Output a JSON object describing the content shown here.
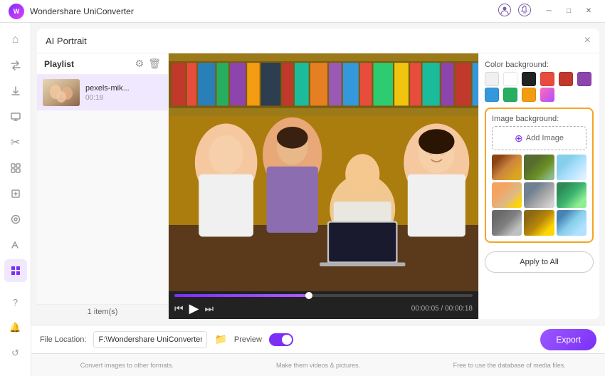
{
  "app": {
    "title": "Wondershare UniConverter",
    "logo_letter": "W"
  },
  "title_bar": {
    "controls": [
      "minimize",
      "maximize",
      "close"
    ],
    "icons": [
      "user-icon",
      "bell-icon"
    ]
  },
  "sidebar": {
    "items": [
      {
        "id": "home",
        "icon": "⌂",
        "label": "Home"
      },
      {
        "id": "convert",
        "icon": "⇄",
        "label": "Convert"
      },
      {
        "id": "download",
        "icon": "↓",
        "label": "Download"
      },
      {
        "id": "screen",
        "icon": "▣",
        "label": "Screen"
      },
      {
        "id": "cut",
        "icon": "✂",
        "label": "Cut"
      },
      {
        "id": "merge",
        "icon": "⊞",
        "label": "Merge"
      },
      {
        "id": "compress",
        "icon": "⊡",
        "label": "Compress"
      },
      {
        "id": "effects",
        "icon": "✦",
        "label": "Effects"
      },
      {
        "id": "tools",
        "icon": "⊞",
        "label": "Tools"
      },
      {
        "id": "grid",
        "icon": "⚏",
        "label": "Grid",
        "active": true
      }
    ],
    "bottom_icons": [
      {
        "id": "help",
        "icon": "?"
      },
      {
        "id": "bell",
        "icon": "🔔"
      },
      {
        "id": "refresh",
        "icon": "↺"
      }
    ]
  },
  "ai_portrait": {
    "title": "AI Portrait",
    "close_label": "×"
  },
  "playlist": {
    "title": "Playlist",
    "items": [
      {
        "name": "pexels-mik...",
        "duration": "00:18"
      }
    ],
    "count_label": "1 item(s)"
  },
  "video_controls": {
    "prev_icon": "⏮",
    "play_icon": "▶",
    "next_icon": "⏭",
    "time_current": "00:00:05",
    "time_total": "00:00:18",
    "time_separator": " / "
  },
  "color_backgrounds": {
    "title": "Color background:",
    "swatches": [
      {
        "color": "#f0f0f0",
        "label": "light-gray"
      },
      {
        "color": "#ffffff",
        "label": "white"
      },
      {
        "color": "#222222",
        "label": "black"
      },
      {
        "color": "#e74c3c",
        "label": "red"
      },
      {
        "color": "#c0392b",
        "label": "dark-red"
      },
      {
        "color": "#8e44ad",
        "label": "purple"
      },
      {
        "color": "#3498db",
        "label": "blue"
      },
      {
        "color": "#27ae60",
        "label": "green"
      },
      {
        "color": "#f39c12",
        "label": "orange"
      },
      {
        "color": "#e056a0",
        "label": "pink"
      }
    ]
  },
  "image_background": {
    "title": "Image background:",
    "add_image_label": "Add Image",
    "thumbnails": [
      {
        "id": "bg1",
        "class": "bg-t1"
      },
      {
        "id": "bg2",
        "class": "bg-t2"
      },
      {
        "id": "bg3",
        "class": "bg-t3"
      },
      {
        "id": "bg4",
        "class": "bg-t4"
      },
      {
        "id": "bg5",
        "class": "bg-t5"
      },
      {
        "id": "bg6",
        "class": "bg-t6"
      },
      {
        "id": "bg7",
        "class": "bg-t7"
      },
      {
        "id": "bg8",
        "class": "bg-t8"
      },
      {
        "id": "bg9",
        "class": "bg-t9"
      }
    ]
  },
  "apply_all": {
    "label": "Apply to All"
  },
  "bottom_bar": {
    "file_location_label": "File Location:",
    "file_path": "F:\\Wondershare UniConverter",
    "preview_label": "Preview",
    "export_label": "Export"
  },
  "bottom_hints": [
    "Convert images to other formats.",
    "Make them videos & pictures.",
    "Free to use the database of media files."
  ]
}
